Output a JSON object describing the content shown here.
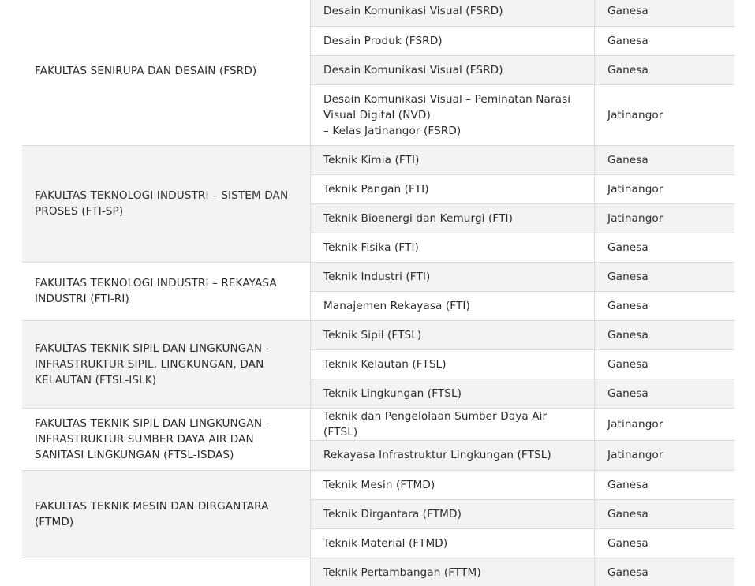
{
  "faculties": [
    {
      "name": "FAKULTAS SENIRUPA DAN DESAIN (FSRD)",
      "programs": [
        {
          "name": "Desain Komunikasi Visual (FSRD)",
          "campus": "Ganesa"
        },
        {
          "name": "Desain Produk (FSRD)",
          "campus": "Ganesa"
        },
        {
          "name": "Desain Komunikasi Visual (FSRD)",
          "campus": "Ganesa"
        },
        {
          "lines": [
            "Desain Komunikasi Visual – Peminatan Narasi",
            "Visual Digital (NVD)",
            "– Kelas Jatinangor (FSRD)"
          ],
          "campus": "Jatinangor"
        }
      ]
    },
    {
      "name": "FAKULTAS TEKNOLOGI INDUSTRI – SISTEM DAN PROSES (FTI-SP)",
      "programs": [
        {
          "name": "Teknik Kimia (FTI)",
          "campus": "Ganesa"
        },
        {
          "name": "Teknik Pangan (FTI)",
          "campus": "Jatinangor"
        },
        {
          "name": "Teknik Bioenergi dan Kemurgi (FTI)",
          "campus": "Jatinangor"
        },
        {
          "name": "Teknik Fisika (FTI)",
          "campus": "Ganesa"
        }
      ]
    },
    {
      "name": "FAKULTAS TEKNOLOGI INDUSTRI – REKAYASA INDUSTRI (FTI-RI)",
      "programs": [
        {
          "name": "Teknik Industri (FTI)",
          "campus": "Ganesa"
        },
        {
          "name": "Manajemen Rekayasa (FTI)",
          "campus": "Ganesa"
        }
      ]
    },
    {
      "name": "FAKULTAS TEKNIK SIPIL DAN LINGKUNGAN - INFRASTRUKTUR SIPIL, LINGKUNGAN, DAN KELAUTAN (FTSL-ISLK)",
      "programs": [
        {
          "name": "Teknik Sipil (FTSL)",
          "campus": "Ganesa"
        },
        {
          "name": "Teknik Kelautan (FTSL)",
          "campus": "Ganesa"
        },
        {
          "name": "Teknik Lingkungan (FTSL)",
          "campus": "Ganesa"
        }
      ]
    },
    {
      "name": "FAKULTAS TEKNIK SIPIL DAN LINGKUNGAN - INFRASTRUKTUR SUMBER DAYA AIR DAN SANITASI LINGKUNGAN (FTSL-ISDAS)",
      "programs": [
        {
          "name": "Teknik dan Pengelolaan Sumber Daya Air (FTSL)",
          "campus": "Jatinangor"
        },
        {
          "name": "Rekayasa Infrastruktur Lingkungan (FTSL)",
          "campus": "Jatinangor"
        }
      ]
    },
    {
      "name": "FAKULTAS TEKNIK MESIN DAN DIRGANTARA (FTMD)",
      "programs": [
        {
          "name": "Teknik Mesin (FTMD)",
          "campus": "Ganesa"
        },
        {
          "name": "Teknik Dirgantara (FTMD)",
          "campus": "Ganesa"
        },
        {
          "name": "Teknik Material (FTMD)",
          "campus": "Ganesa"
        }
      ]
    },
    {
      "name": "",
      "programs": [
        {
          "name": "Teknik Pertambangan (FTTM)",
          "campus": "Ganesa"
        }
      ]
    }
  ]
}
